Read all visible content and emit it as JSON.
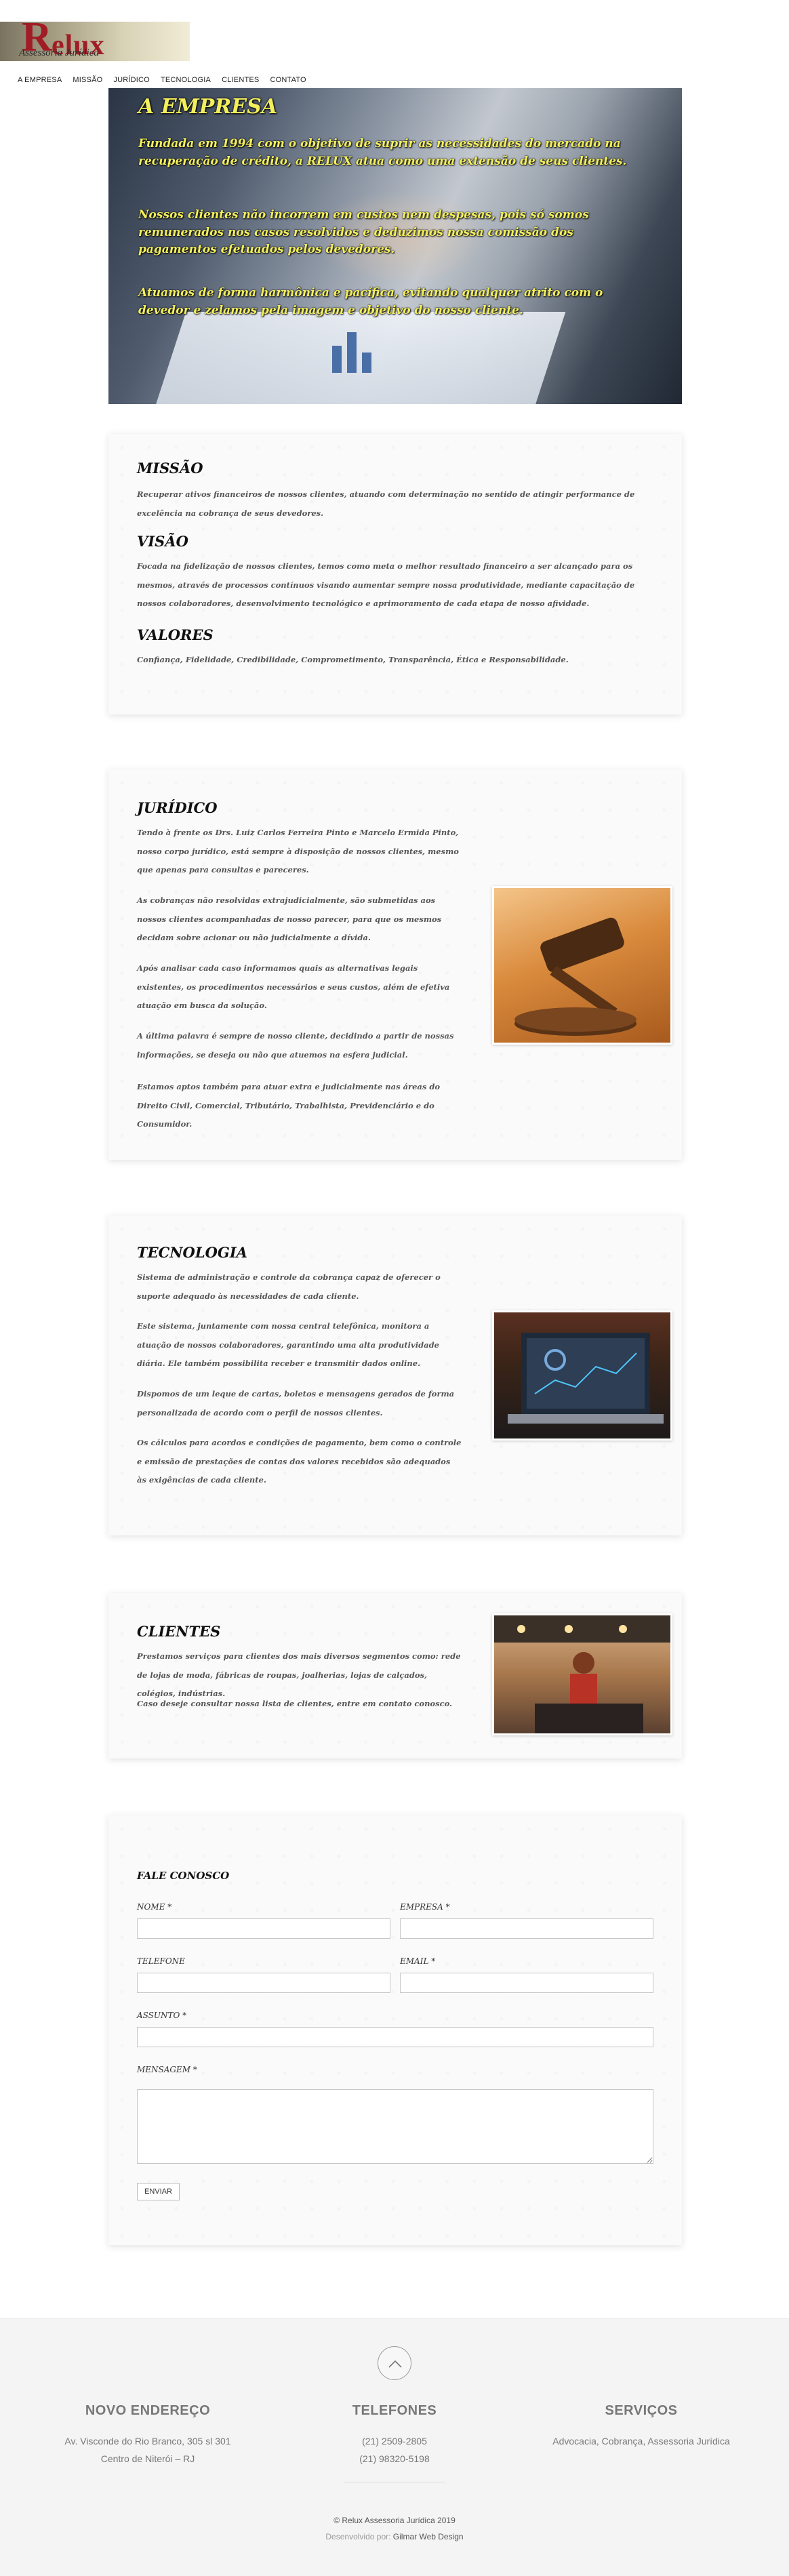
{
  "header": {
    "logo_mark": "R",
    "logo_word": "elux",
    "logo_sub": "Assessoria Jurídica",
    "nav": [
      "A EMPRESA",
      "MISSÃO",
      "JURÍDICO",
      "TECNOLOGIA",
      "CLIENTES",
      "CONTATO"
    ]
  },
  "hero": {
    "title": "A EMPRESA",
    "p1": "Fundada em 1994 com o objetivo de suprir as necessidades do mercado na recuperação de crédito, a RELUX atua como uma extensão de seus clientes.",
    "p2": "Nossos clientes não incorrem em custos nem despesas, pois só somos remunerados nos casos resolvidos e deduzimos nossa comissão dos pagamentos efetuados pelos devedores.",
    "p3": "Atuamos de forma harmônica e pacífica, evitando qualquer atrito com o devedor e zelamos pela imagem e objetivo do nosso cliente."
  },
  "missao": {
    "t1": "MISSÃO",
    "p1": "Recuperar ativos financeiros de nossos clientes, atuando com determinação no sentido de atingir performance de excelência na cobrança de seus devedores.",
    "t2": "VISÃO",
    "p2": "Focada na fidelização de nossos clientes, temos como meta o melhor resultado financeiro a ser alcançado para os mesmos, através de processos contínuos visando aumentar sempre nossa produtividade, mediante capacitação de nossos colaboradores, desenvolvimento tecnológico e aprimoramento de cada etapa de nosso afividade.",
    "t3": "VALORES",
    "p3": "Confiança, Fidelidade, Credibilidade, Comprometimento, Transparência, Ética e Responsabilidade."
  },
  "juridico": {
    "title": "JURÍDICO",
    "p1": "Tendo à frente os Drs. Luiz Carlos Ferreira Pinto e Marcelo Ermida Pinto, nosso corpo jurídico, está sempre à disposição de nossos clientes, mesmo que apenas para consultas e pareceres.",
    "p2": "As cobranças não resolvidas extrajudicialmente, são submetidas aos nossos clientes acompanhadas de nosso parecer, para que os mesmos decidam sobre acionar ou não judicialmente a dívida.",
    "p3": "Após analisar cada caso informamos quais as alternativas legais existentes, os procedimentos necessários e seus custos, além de efetiva atuação em busca da solução.",
    "p4": "A última palavra é sempre de nosso cliente, decidindo a partir de nossas informações, se deseja ou não que atuemos na esfera judicial.",
    "p5": "Estamos aptos também para atuar extra e judicialmente nas áreas do Direito Civil, Comercial, Tributário, Trabalhista, Previdenciário e do Consumidor."
  },
  "tecnologia": {
    "title": "TECNOLOGIA",
    "p1": "Sistema de administração e controle da cobrança capaz de oferecer o suporte adequado às necessidades de cada cliente.",
    "p2": "Este sistema, juntamente com nossa central telefônica, monitora a atuação de nossos colaboradores, garantindo uma alta produtividade diária. Ele também possibilita receber e transmitir dados online.",
    "p3": "Dispomos de um leque de cartas, boletos e mensagens gerados de forma personalizada de acordo com o perfil de nossos clientes.",
    "p4": "Os cálculos para acordos e condições de pagamento, bem como o controle e emissão de prestações de contas dos valores recebidos são adequados às exigências de cada cliente."
  },
  "clientes": {
    "title": "CLIENTES",
    "p1": "Prestamos serviços para clientes dos mais diversos segmentos como: rede de lojas de moda, fábricas de roupas, joalherias, lojas de calçados, colégios, indústrias.",
    "p2": "Caso deseje consultar nossa lista de clientes, entre em contato conosco."
  },
  "contato": {
    "title": "FALE CONOSCO",
    "nome": "NOME *",
    "empresa": "EMPRESA *",
    "telefone": "TELEFONE",
    "email": "EMAIL *",
    "assunto": "ASSUNTO *",
    "mensagem": "MENSAGEM *",
    "submit": "ENVIAR"
  },
  "footer": {
    "endereco_title": "NOVO ENDEREÇO",
    "endereco_l1": "Av. Visconde do Rio Branco, 305 sl 301",
    "endereco_l2": "Centro de Niterói – RJ",
    "telefones_title": "TELEFONES",
    "tel1": "(21) 2509-2805",
    "tel2": "(21) 98320-5198",
    "servicos_title": "SERVIÇOS",
    "servicos_l1": "Advocacia, Cobrança, Assessoria Jurídica",
    "copyright": "© Relux Assessoria Jurídica 2019",
    "dev_prefix": "Desenvolvido por:",
    "dev_name": "Gilmar Web Design"
  },
  "colors": {
    "brand_red": "#a01d25",
    "hero_text": "#f3ef5c"
  }
}
